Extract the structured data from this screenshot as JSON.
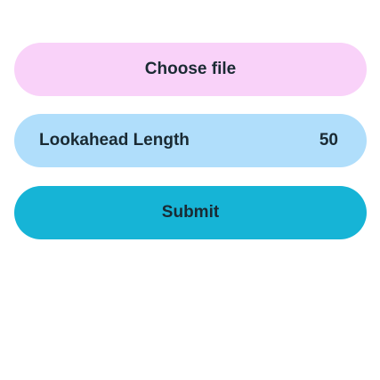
{
  "file_input": {
    "label": "Choose file"
  },
  "lookahead": {
    "label": "Lookahead Length",
    "value": "50"
  },
  "submit": {
    "label": "Submit"
  },
  "colors": {
    "file_bg": "#f9d2f9",
    "param_bg": "#b0defb",
    "submit_bg": "#16b4d6",
    "text": "#1a2a33"
  }
}
